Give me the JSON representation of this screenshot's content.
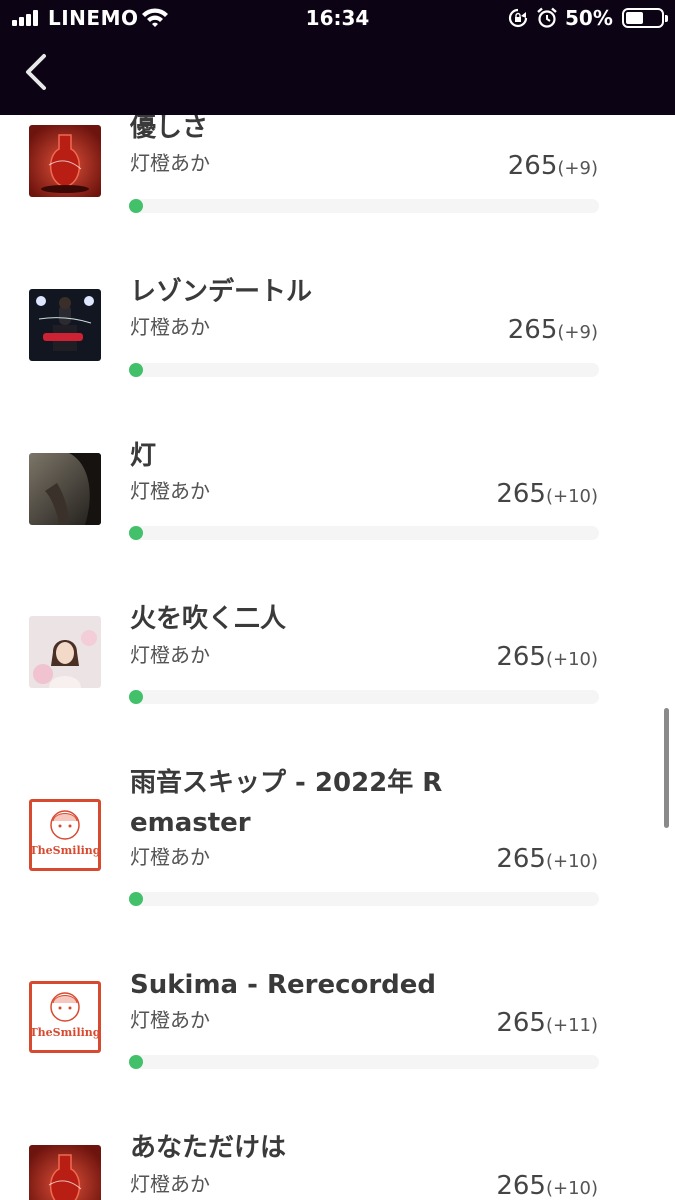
{
  "status_bar": {
    "carrier": "LINEMO",
    "time": "16:34",
    "battery_percent": "50%",
    "battery_level": 0.5,
    "icons": [
      "signal-icon",
      "wifi-icon",
      "rotation-lock-icon",
      "alarm-icon",
      "battery-icon"
    ]
  },
  "header": {
    "back_icon": "chevron-left-icon"
  },
  "colors": {
    "header_bg": "#0c0414",
    "progress": "#43c06a",
    "track": "#f5f5f5"
  },
  "songs": [
    {
      "title": "優しさ",
      "artist": "灯橙あか",
      "score": "265",
      "delta": "(+9)",
      "art": "red-bottle"
    },
    {
      "title": "レゾンデートル",
      "artist": "灯橙あか",
      "score": "265",
      "delta": "(+9)",
      "art": "guitar-stage"
    },
    {
      "title": "灯",
      "artist": "灯橙あか",
      "score": "265",
      "delta": "(+10)",
      "art": "dark-portrait"
    },
    {
      "title": "火を吹く二人",
      "artist": "灯橙あか",
      "score": "265",
      "delta": "(+10)",
      "art": "pink-portrait"
    },
    {
      "title": "雨音スキップ - 2022年 Remaster",
      "artist": "灯橙あか",
      "score": "265",
      "delta": "(+10)",
      "art": "the-smiling"
    },
    {
      "title": "Sukima - Rerecorded",
      "artist": "灯橙あか",
      "score": "265",
      "delta": "(+11)",
      "art": "the-smiling"
    },
    {
      "title": "あなただけは",
      "artist": "灯橙あか",
      "score": "265",
      "delta": "(+10)",
      "art": "red-bottle"
    }
  ]
}
